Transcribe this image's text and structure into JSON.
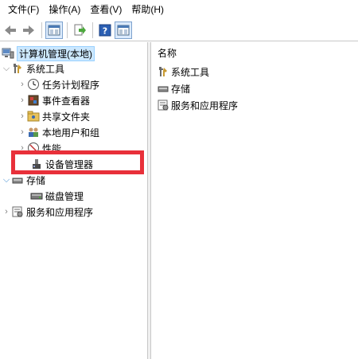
{
  "menubar": {
    "items": [
      "文件(F)",
      "操作(A)",
      "查看(V)",
      "帮助(H)"
    ]
  },
  "toolbar": {
    "buttons": [
      "back-icon",
      "forward-icon",
      "show-hide-tree-icon",
      "export-list-icon",
      "help-icon",
      "properties-icon"
    ]
  },
  "tree": {
    "root": "计算机管理(本地)",
    "system_tools": "系统工具",
    "task_scheduler": "任务计划程序",
    "event_viewer": "事件查看器",
    "shared_folders": "共享文件夹",
    "local_users": "本地用户和组",
    "performance": "性能",
    "device_manager": "设备管理器",
    "storage": "存储",
    "disk_management": "磁盘管理",
    "services_apps": "服务和应用程序"
  },
  "right_pane": {
    "column_header": "名称",
    "items": [
      "系统工具",
      "存储",
      "服务和应用程序"
    ]
  },
  "colors": {
    "highlight": "#e8303a",
    "selection": "#cce8ff"
  }
}
